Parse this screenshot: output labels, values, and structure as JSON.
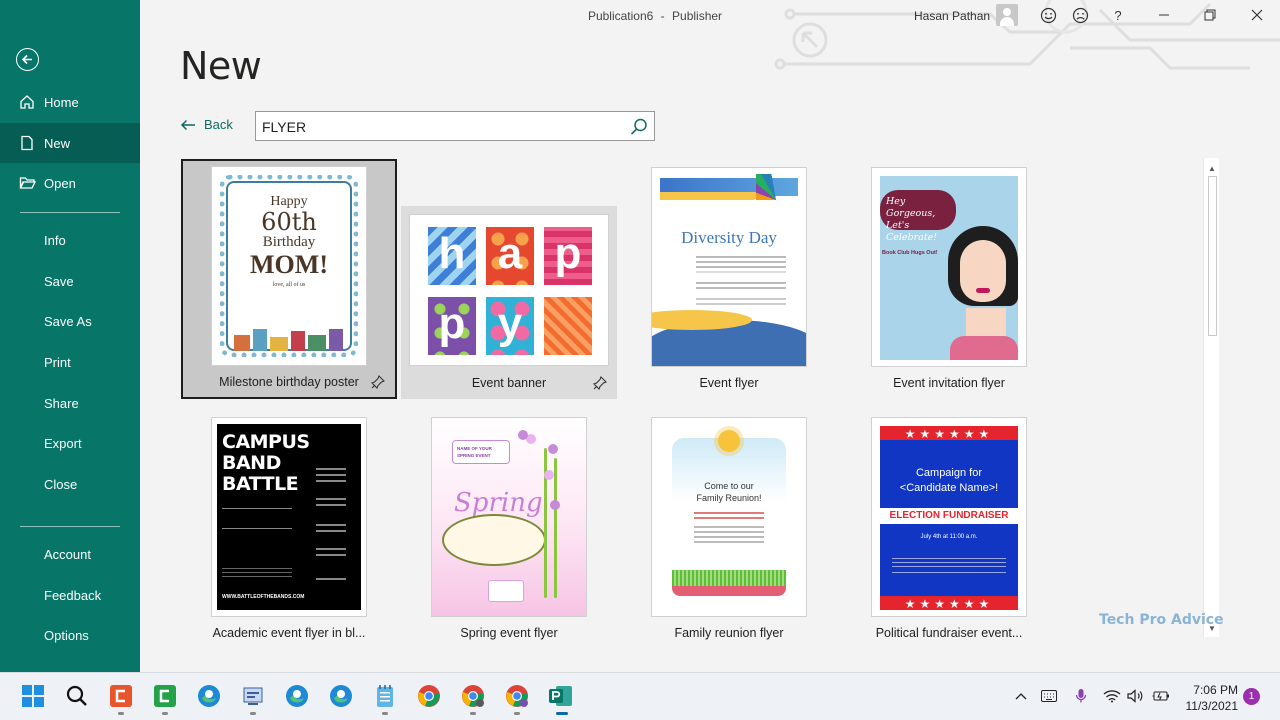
{
  "window": {
    "document_name": "Publication6",
    "separator": "-",
    "app_name": "Publisher",
    "user_name": "Hasan Pathan",
    "help_label": "?"
  },
  "sidebar": {
    "items": [
      {
        "label": "Home",
        "icon": "home-icon"
      },
      {
        "label": "New",
        "icon": "new-document-icon"
      },
      {
        "label": "Open",
        "icon": "folder-open-icon"
      },
      {
        "label": "Info"
      },
      {
        "label": "Save"
      },
      {
        "label": "Save As"
      },
      {
        "label": "Print"
      },
      {
        "label": "Share"
      },
      {
        "label": "Export"
      },
      {
        "label": "Close"
      },
      {
        "label": "Account"
      },
      {
        "label": "Feedback"
      },
      {
        "label": "Options"
      }
    ]
  },
  "main": {
    "heading": "New",
    "back_label": "Back",
    "search_value": "FLYER"
  },
  "templates": [
    {
      "label": "Milestone birthday poster",
      "state": "selected",
      "pinnable": true,
      "thumb_text": [
        "Happy",
        "60th",
        "Birthday",
        "MOM!",
        "love, all of us"
      ]
    },
    {
      "label": "Event banner",
      "state": "hover",
      "pinnable": true,
      "thumb_text": [
        "h",
        "a",
        "p",
        "p",
        "y"
      ]
    },
    {
      "label": "Event flyer",
      "state": "normal",
      "pinnable": false,
      "thumb_text": [
        "Diversity Day"
      ]
    },
    {
      "label": "Event invitation flyer",
      "state": "normal",
      "pinnable": false,
      "thumb_text": [
        "Hey Gorgeous,",
        "Let's Celebrate!",
        "Book Club Hugs Out!"
      ]
    },
    {
      "label": "Academic event flyer in bl...",
      "state": "normal",
      "pinnable": false,
      "thumb_text": [
        "CAMPUS",
        "BAND",
        "BATTLE",
        "WWW.BATTLEOFTHEBANDS.COM"
      ]
    },
    {
      "label": "Spring event flyer",
      "state": "normal",
      "pinnable": false,
      "thumb_text": [
        "NAME OF YOUR",
        "SPRING EVENT",
        "Spring"
      ]
    },
    {
      "label": "Family reunion flyer",
      "state": "normal",
      "pinnable": false,
      "thumb_text": [
        "Come to our",
        "Family Reunion!"
      ]
    },
    {
      "label": "Political fundraiser event...",
      "state": "normal",
      "pinnable": false,
      "thumb_text": [
        "Campaign for",
        "<Candidate Name>!",
        "ELECTION FUNDRAISER",
        "July 4th at 11:00 a.m."
      ]
    }
  ],
  "watermark": "Tech Pro Advice",
  "taskbar": {
    "time": "7:06 PM",
    "date": "11/3/2021",
    "notification_count": "1",
    "apps": [
      "windows-start-icon",
      "search-icon",
      "app-icon",
      "app-icon",
      "edge-icon",
      "app-icon",
      "edge-icon",
      "edge-icon",
      "notepad-icon",
      "chrome-icon",
      "chrome-icon",
      "chrome-icon",
      "publisher-icon"
    ]
  },
  "colors": {
    "sidebar": "#077568",
    "sidebar_active": "#055d53",
    "accent": "#0e6b5f"
  }
}
